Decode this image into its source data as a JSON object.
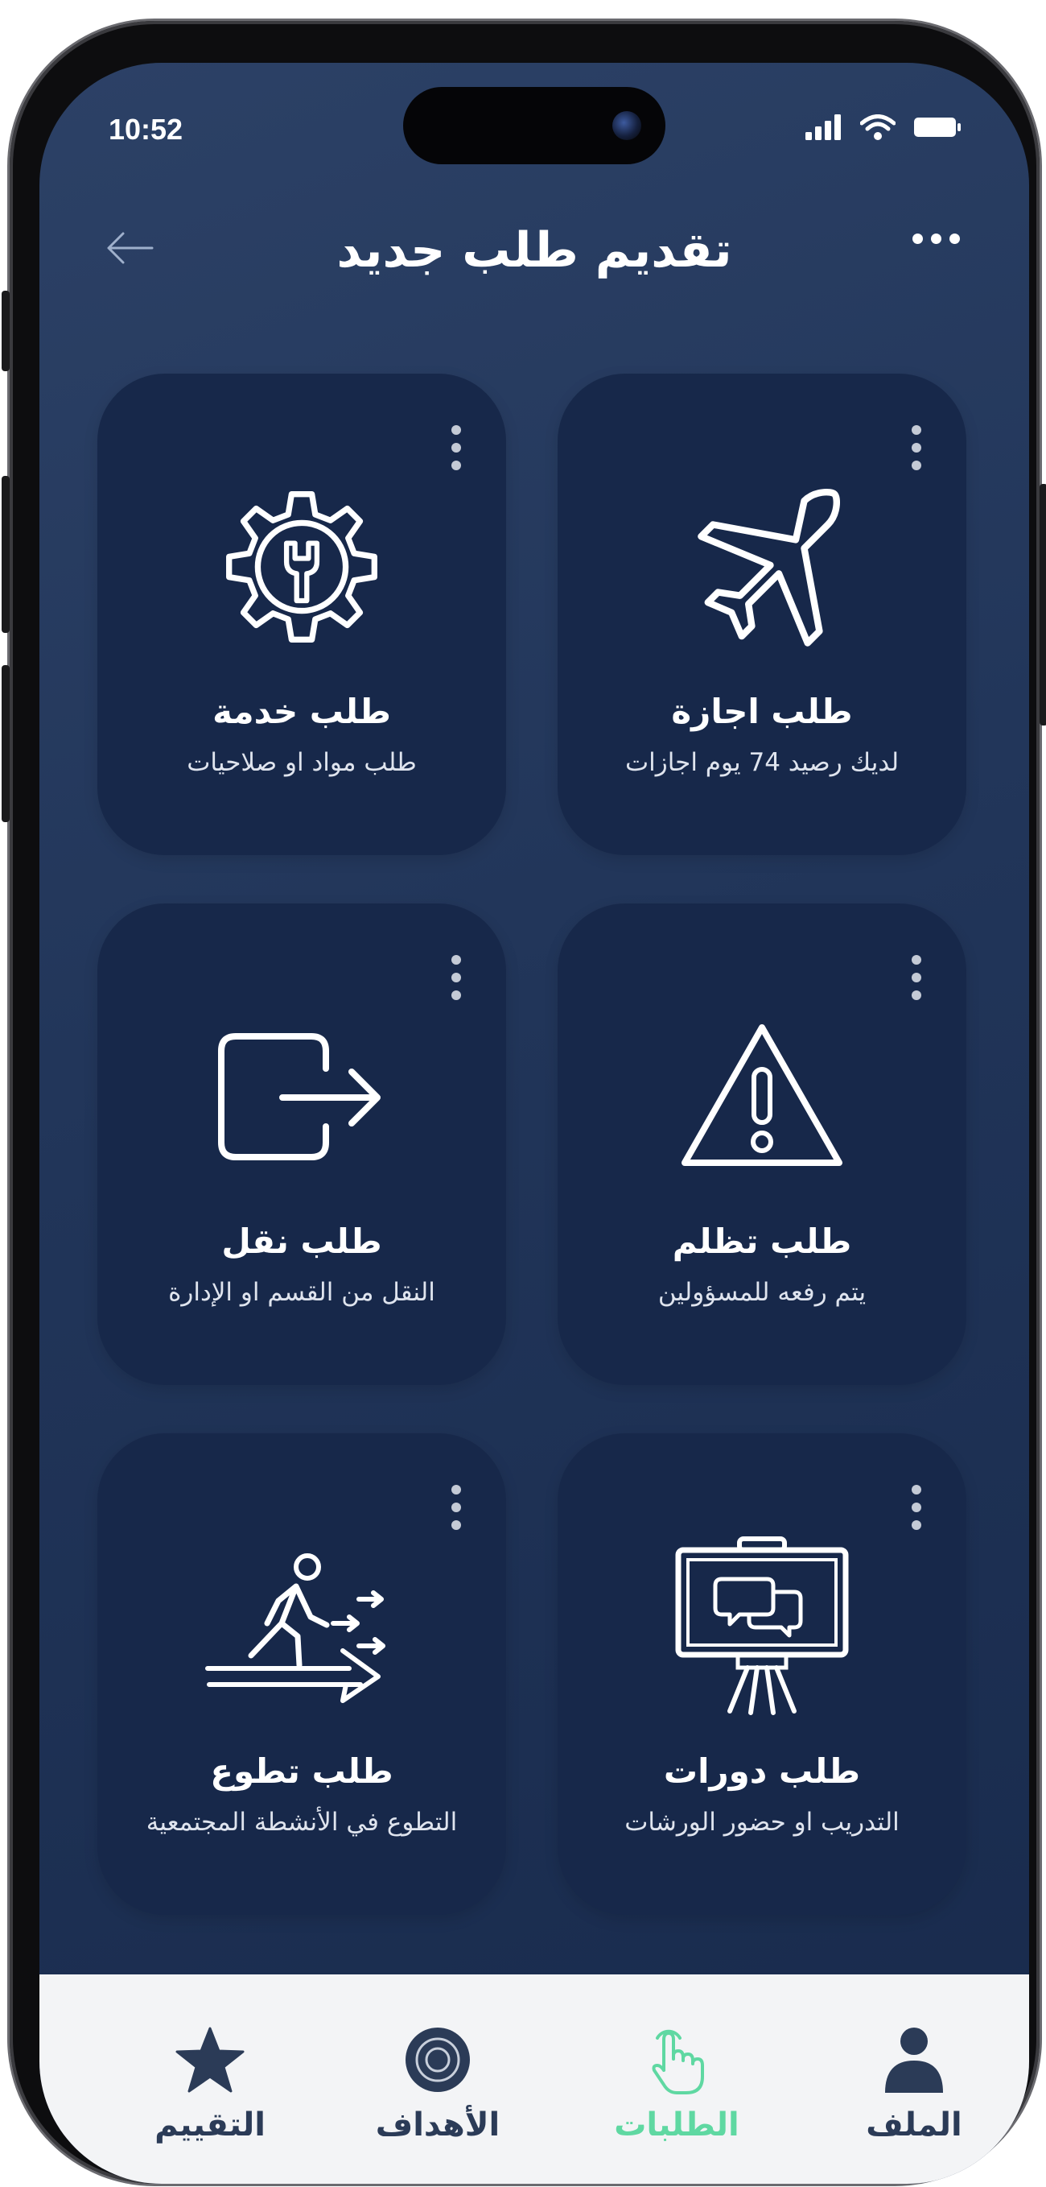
{
  "status": {
    "time": "10:52"
  },
  "header": {
    "title": "تقديم طلب جديد"
  },
  "cards": [
    {
      "title": "طلب اجازة",
      "subtitle": "لديك رصيد 74 يوم اجازات",
      "icon": "airplane-icon"
    },
    {
      "title": "طلب خدمة",
      "subtitle": "طلب مواد او صلاحيات",
      "icon": "gear-wrench-icon"
    },
    {
      "title": "طلب تظلم",
      "subtitle": "يتم رفعه للمسؤولين",
      "icon": "warning-icon"
    },
    {
      "title": "طلب نقل",
      "subtitle": "النقل من القسم او الإدارة",
      "icon": "exit-arrow-icon"
    },
    {
      "title": "طلب دورات",
      "subtitle": "التدريب او حضور الورشات",
      "icon": "presentation-board-icon"
    },
    {
      "title": "طلب تطوع",
      "subtitle": "التطوع في الأنشطة المجتمعية",
      "icon": "person-walking-forward-icon"
    }
  ],
  "nav": [
    {
      "label": "الملف",
      "icon": "user-icon",
      "active": false
    },
    {
      "label": "الطلبات",
      "icon": "tap-hand-icon",
      "active": true
    },
    {
      "label": "الأهداف",
      "icon": "target-icon",
      "active": false
    },
    {
      "label": "التقييم",
      "icon": "star-icon",
      "active": false
    }
  ],
  "colors": {
    "background": "#213559",
    "card": "#17284a",
    "accent": "#5fd8a2",
    "nav_bg": "#f3f4f6",
    "nav_text": "#2b3b57"
  }
}
